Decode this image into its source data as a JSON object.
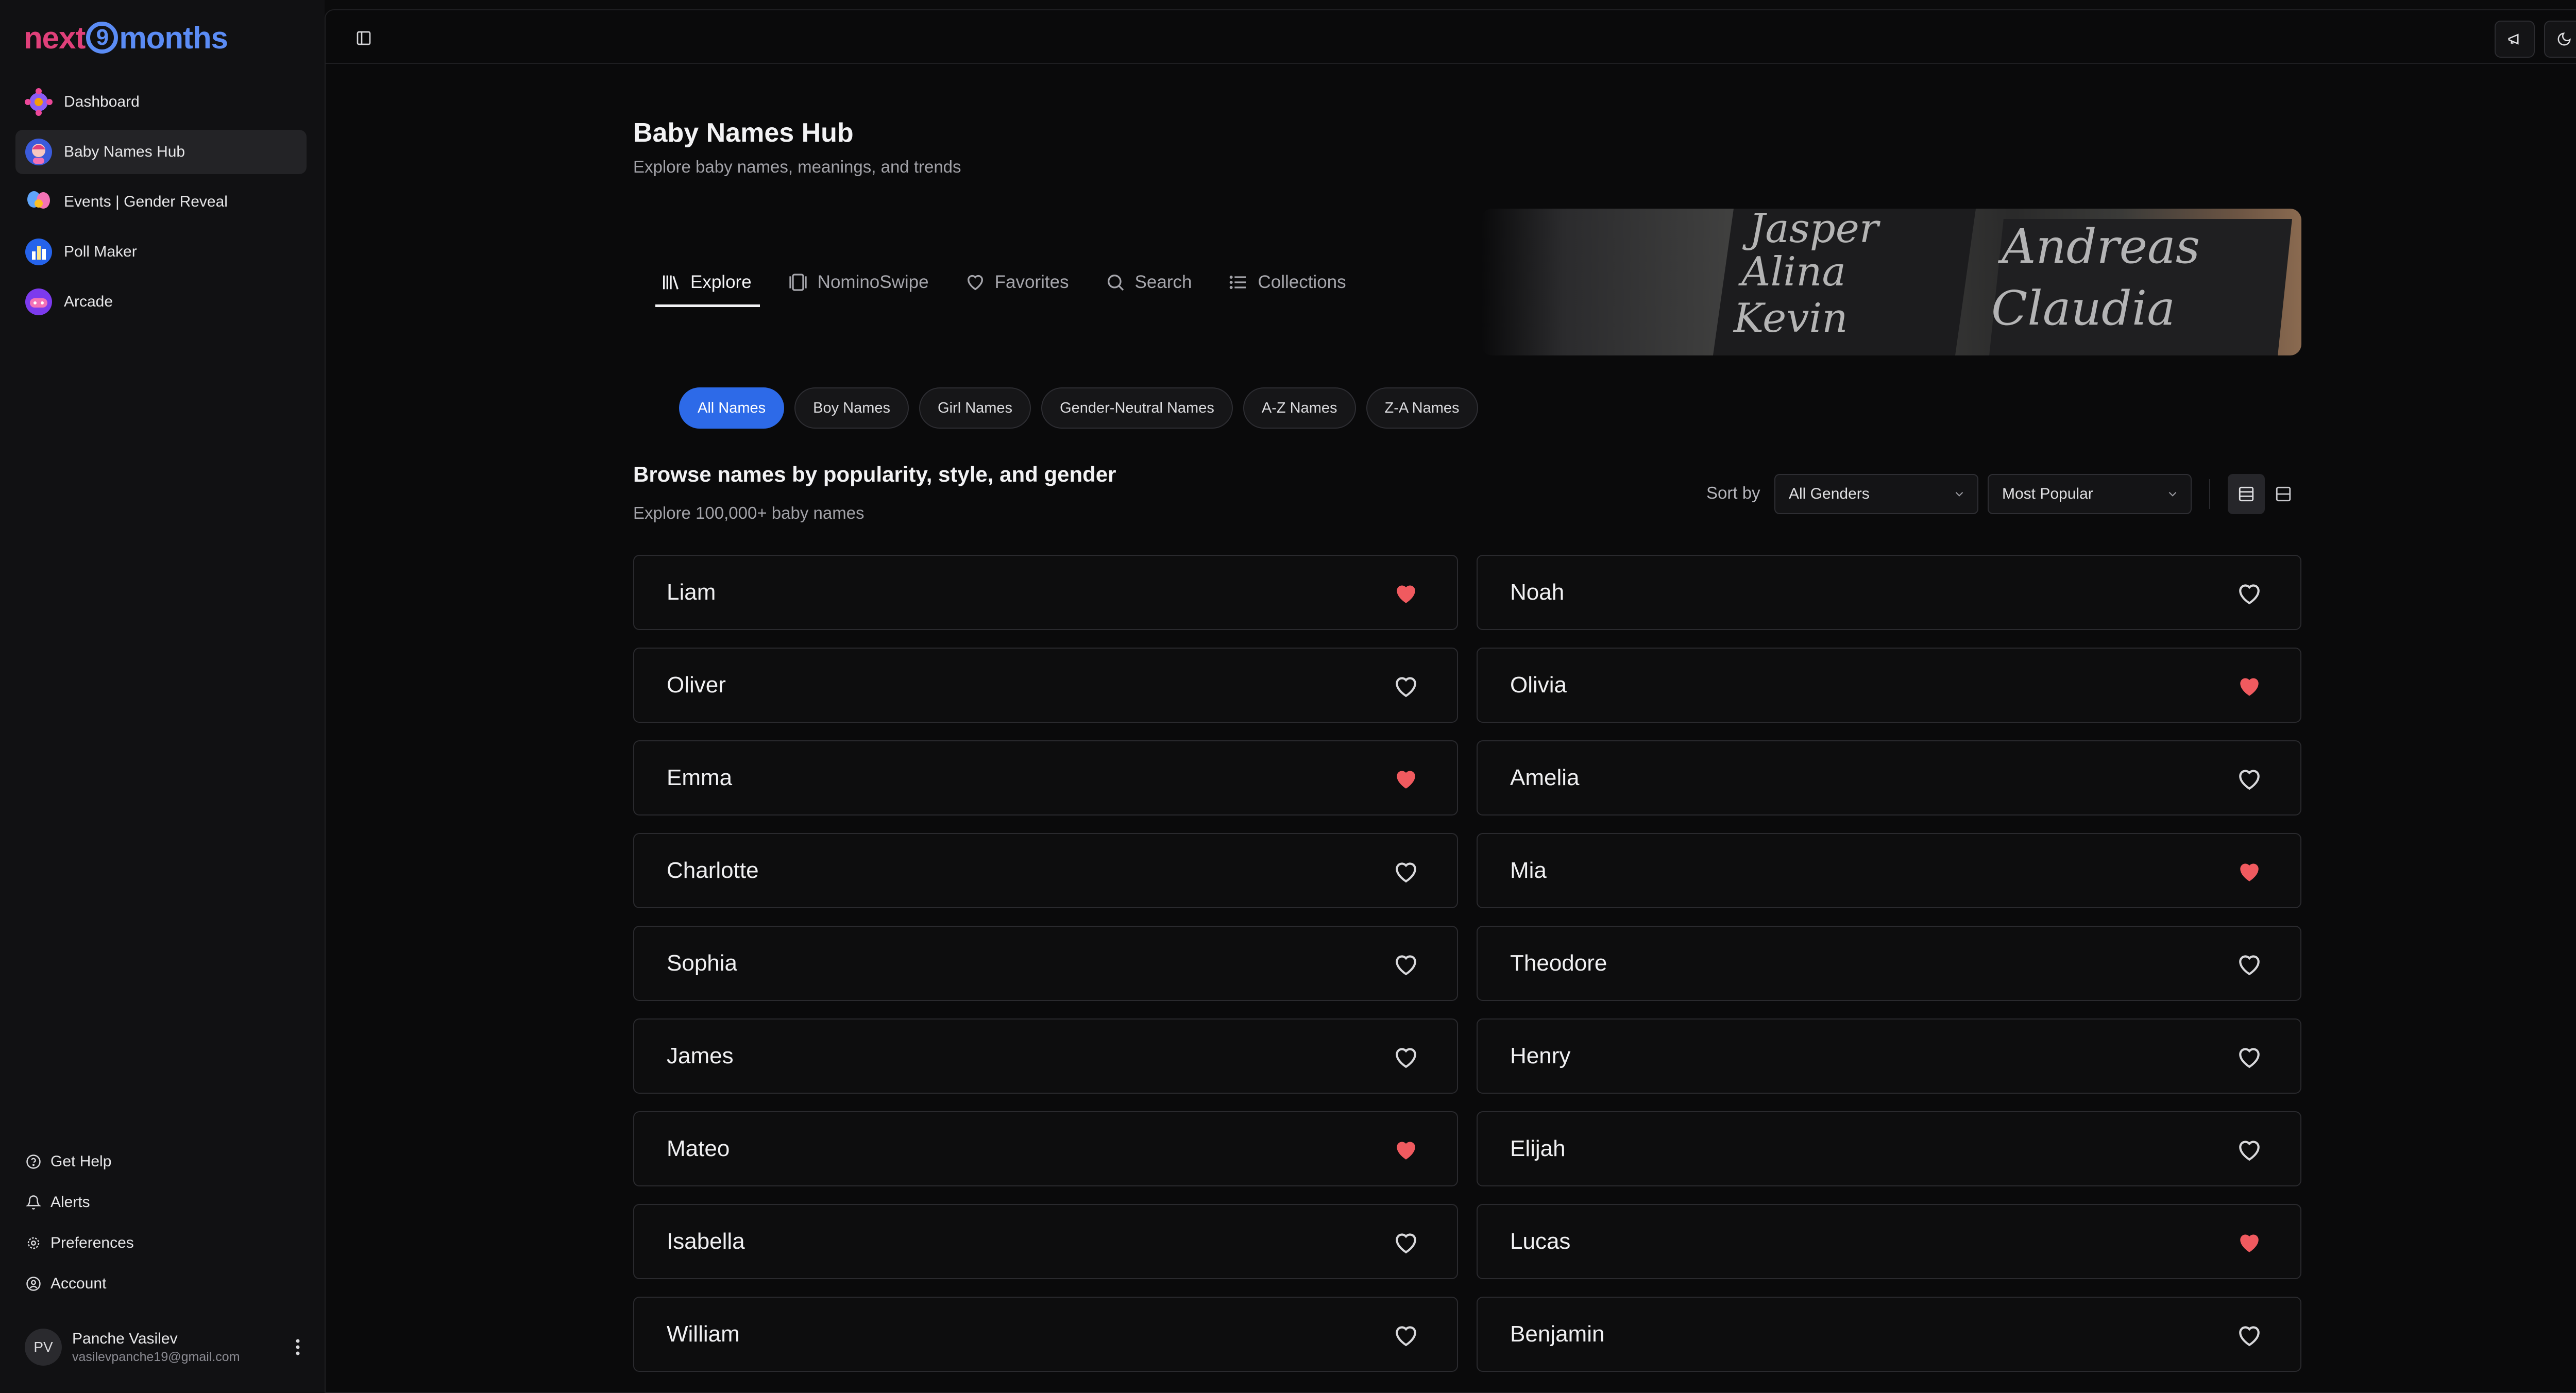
{
  "app": {
    "logo_left": "next",
    "logo_nine": "9",
    "logo_right": "months"
  },
  "sidebar": {
    "items": [
      {
        "label": "Dashboard",
        "icon": "gear-flower-icon"
      },
      {
        "label": "Baby Names Hub",
        "icon": "baby-icon",
        "active": true
      },
      {
        "label": "Events | Gender Reveal",
        "icon": "balloons-icon"
      },
      {
        "label": "Poll Maker",
        "icon": "chart-icon"
      },
      {
        "label": "Arcade",
        "icon": "gamepad-icon"
      }
    ],
    "bottom_items": [
      {
        "label": "Get Help",
        "icon": "help-circle-icon"
      },
      {
        "label": "Alerts",
        "icon": "bell-icon"
      },
      {
        "label": "Preferences",
        "icon": "settings-icon"
      },
      {
        "label": "Account",
        "icon": "user-circle-icon"
      }
    ],
    "user": {
      "initials": "PV",
      "name": "Panche Vasilev",
      "email": "vasilevpanche19@gmail.com"
    }
  },
  "page": {
    "title": "Baby Names Hub",
    "subtitle": "Explore baby names, meanings, and trends"
  },
  "tabs": [
    {
      "label": "Explore",
      "icon": "library-icon",
      "active": true
    },
    {
      "label": "NominoSwipe",
      "icon": "swipe-cards-icon"
    },
    {
      "label": "Favorites",
      "icon": "heart-icon"
    },
    {
      "label": "Search",
      "icon": "search-icon"
    },
    {
      "label": "Collections",
      "icon": "list-icon"
    }
  ],
  "banner": {
    "words_left": [
      "Jasper",
      "Alina",
      "Kevin"
    ],
    "words_right": [
      "Andreas",
      "Claudia"
    ]
  },
  "filters": [
    {
      "label": "All Names",
      "active": true
    },
    {
      "label": "Boy Names"
    },
    {
      "label": "Girl Names"
    },
    {
      "label": "Gender-Neutral Names"
    },
    {
      "label": "A-Z Names"
    },
    {
      "label": "Z-A Names"
    }
  ],
  "browse": {
    "title": "Browse names by popularity, style, and gender",
    "subtitle": "Explore 100,000+ baby names",
    "sort_label": "Sort by",
    "gender_select": "All Genders",
    "order_select": "Most Popular"
  },
  "colors": {
    "accent": "#2d6ae8",
    "heart_filled": "#f05a5f",
    "background": "#0a0a0b"
  },
  "names": [
    {
      "name": "Liam",
      "favorite": true
    },
    {
      "name": "Noah",
      "favorite": false
    },
    {
      "name": "Oliver",
      "favorite": false
    },
    {
      "name": "Olivia",
      "favorite": true
    },
    {
      "name": "Emma",
      "favorite": true
    },
    {
      "name": "Amelia",
      "favorite": false
    },
    {
      "name": "Charlotte",
      "favorite": false
    },
    {
      "name": "Mia",
      "favorite": true
    },
    {
      "name": "Sophia",
      "favorite": false
    },
    {
      "name": "Theodore",
      "favorite": false
    },
    {
      "name": "James",
      "favorite": false
    },
    {
      "name": "Henry",
      "favorite": false
    },
    {
      "name": "Mateo",
      "favorite": true
    },
    {
      "name": "Elijah",
      "favorite": false
    },
    {
      "name": "Isabella",
      "favorite": false
    },
    {
      "name": "Lucas",
      "favorite": true
    },
    {
      "name": "William",
      "favorite": false
    },
    {
      "name": "Benjamin",
      "favorite": false
    }
  ]
}
